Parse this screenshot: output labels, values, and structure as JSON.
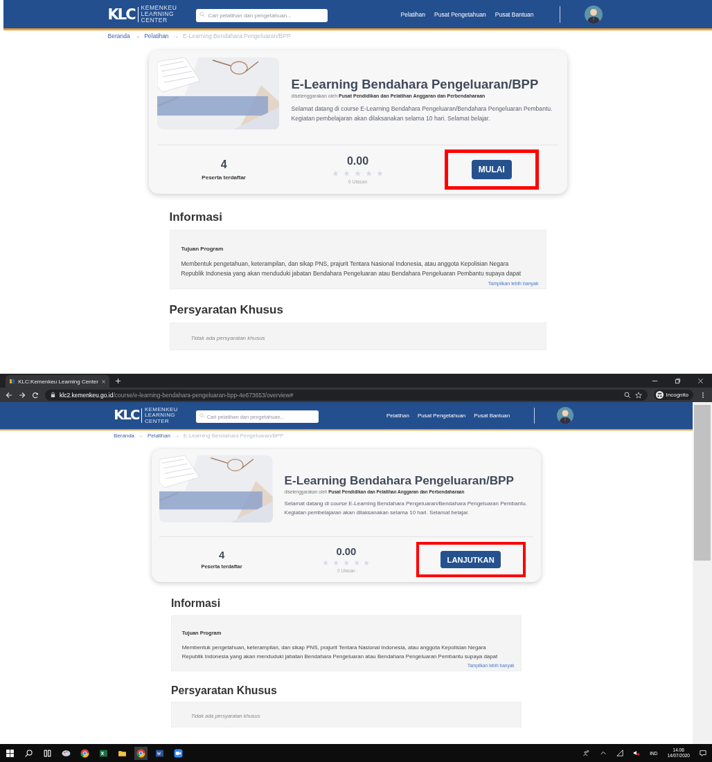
{
  "screens": [
    {
      "header": {
        "logo_mark": "KLC",
        "logo_lines": [
          "KEMENKEU",
          "LEARNING",
          "CENTER"
        ],
        "search_placeholder": "Cari pelatihan dan pengetahuan...",
        "nav": [
          "Pelatihan",
          "Pusat Pengetahuan",
          "Pusat Bantuan"
        ]
      },
      "breadcrumb": {
        "separator": "→",
        "items": [
          {
            "label": "Beranda",
            "current": false
          },
          {
            "label": "Pelatihan",
            "current": false
          },
          {
            "label": "E-Learning Bendahara Pengeluaran/BPP",
            "current": true
          }
        ]
      },
      "course": {
        "title": "E-Learning Bendahara Pengeluaran/BPP",
        "organizer": "diselenggarakan oleh **Pusat Pendidikan dan Pelatihan Anggaran dan Perbendaharaan**",
        "description": "Selamat datang di course E-Learning Bendahara Pengeluaran/Bendahara Pengeluaran Pembantu. Kegiatan pembelajaran akan dilaksanakan selama 10 hari. Selamat belajar.",
        "participants": "4",
        "participants_label": "Peserta terdaftar",
        "rating": "0.00",
        "stars": 0,
        "reviews": "0 Ulasan",
        "action": {
          "label": "MULAI",
          "highlighted": true
        }
      },
      "info": {
        "title": "Informasi",
        "subtitle": "Tujuan Program",
        "text": "Membentuk pengetahuan, keterampilan, dan sikap PNS, prajurit Tentara Nasional Indonesia, atau anggota Kepolisian Negara Republik Indonesia yang akan menduduki jabatan Bendahara Pengeluaran atau Bendahara Pengeluaran Pembantu supaya dapat",
        "more_link": "Tampilkan lebih banyak"
      },
      "requirements": {
        "title": "Persyaratan Khusus",
        "text": "Tidak ada persyaratan khusus"
      }
    },
    {
      "browser": {
        "tab_title": "KLC:Kemenkeu Learning Center",
        "url_host": "klc2.kemenkeu.go.id",
        "url_path": "/course/e-learning-bendahara-pengeluaran-bpp-4e673653/overview#",
        "profile": "Incognito"
      },
      "header": {
        "logo_mark": "KLC",
        "logo_lines": [
          "KEMENKEU",
          "LEARNING",
          "CENTER"
        ],
        "search_placeholder": "Cari pelatihan dan pengetahuan...",
        "nav": [
          "Pelatihan",
          "Pusat Pengetahuan",
          "Pusat Bantuan"
        ]
      },
      "breadcrumb": {
        "separator": "→",
        "items": [
          {
            "label": "Beranda",
            "current": false
          },
          {
            "label": "Pelatihan",
            "current": false
          },
          {
            "label": "E-Learning Bendahara Pengeluaran/BPP",
            "current": true
          }
        ]
      },
      "course": {
        "title": "E-Learning Bendahara Pengeluaran/BPP",
        "organizer": "diselenggarakan oleh **Pusat Pendidikan dan Pelatihan Anggaran dan Perbendaharaan**",
        "description": "Selamat datang di course E-Learning Bendahara Pengeluaran/Bendahara Pengeluaran Pembantu. Kegiatan pembelajaran akan dilaksanakan selama 10 hari. Selamat belajar.",
        "participants": "4",
        "participants_label": "Peserta terdaftar",
        "rating": "0.00",
        "stars": 0,
        "reviews": "0 Ulasan",
        "action": {
          "label": "LANJUTKAN",
          "highlighted": true
        }
      },
      "info": {
        "title": "Informasi",
        "subtitle": "Tujuan Program",
        "text": "Membentuk pengetahuan, keterampilan, dan sikap PNS, prajurit Tentara Nasional Indonesia, atau anggota Kepolisian Negara Republik Indonesia yang akan menduduki jabatan Bendahara Pengeluaran atau Bendahara Pengeluaran Pembantu supaya dapat",
        "more_link": "Tampilkan lebih banyak"
      },
      "requirements": {
        "title": "Persyaratan Khusus",
        "text": "Tidak ada persyaratan khusus"
      },
      "taskbar": {
        "language": "IND",
        "time": "14.06",
        "date": "14/07/2020"
      }
    }
  ]
}
